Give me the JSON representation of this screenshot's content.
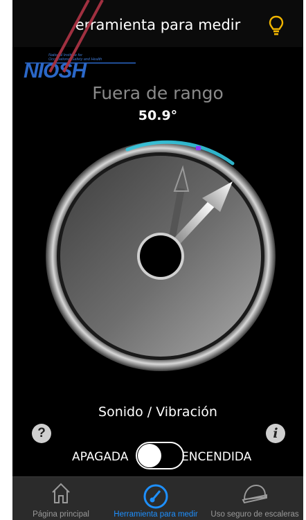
{
  "header": {
    "title": "erramienta para medir",
    "icon": "lightbulb-icon"
  },
  "logo": {
    "text": "NIOSH",
    "subtext_line1": "National Institute for",
    "subtext_line2": "Occupational Safety and Health"
  },
  "gauge": {
    "status": "Fuera de rango",
    "angle": "50.9°",
    "angle_value_deg": 50.9
  },
  "sound": {
    "label": "Sonido / Vibración",
    "off_label": "APAGADA",
    "on_label": "ENCENDIDA",
    "state": "off"
  },
  "buttons": {
    "help": "?",
    "info": "i"
  },
  "tabs": [
    {
      "label": "Página principal",
      "icon": "home-icon",
      "active": false
    },
    {
      "label": "Herramienta para medir",
      "icon": "gauge-icon",
      "active": true
    },
    {
      "label": "Uso seguro de escaleras",
      "icon": "hard-hat-icon",
      "active": false
    }
  ],
  "colors": {
    "background": "#000000",
    "active_tab": "#1e90ff",
    "inactive_tab": "#9a9a9a",
    "bulb": "#f2b600",
    "annotation": "#a03040",
    "arc_cyan": "#34c8e0",
    "arc_purple": "#8a3cff"
  }
}
